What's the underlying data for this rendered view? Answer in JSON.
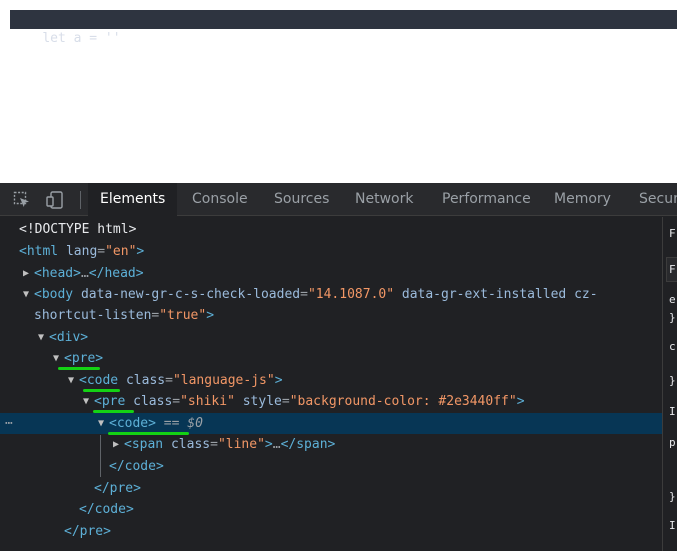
{
  "page": {
    "code_line": "let a = ''"
  },
  "devtools": {
    "tabs": [
      "Elements",
      "Console",
      "Sources",
      "Network",
      "Performance",
      "Memory",
      "Securi"
    ],
    "active_tab": "Elements",
    "tree": {
      "doctype": "<!DOCTYPE html>",
      "html_open": "<html",
      "html_attr": "lang",
      "html_val": "\"en\"",
      "head": "<head>",
      "head_close": "</head>",
      "body_open": "<body",
      "body_attr1": "data-new-gr-c-s-check-loaded",
      "body_val1": "\"14.1087.0\"",
      "body_attr2": "data-gr-ext-installed",
      "body_attr3": "cz-",
      "body_attr3b": "shortcut-listen",
      "body_val3": "\"true\"",
      "div": "<div>",
      "pre": "<pre>",
      "code_open": "<code",
      "code_attr": "class",
      "code_val": "\"language-js\"",
      "pre2_open": "<pre",
      "pre2_attr1": "class",
      "pre2_val1": "\"shiki\"",
      "pre2_attr2": "style",
      "pre2_val2": "\"background-color: #2e3440ff\"",
      "code_sel": "<code>",
      "selected_marker": "== $0",
      "row_dots": "…",
      "span_open": "<span",
      "span_attr": "class",
      "span_val": "\"line\"",
      "span_close": "</span>",
      "code_close": "</code>",
      "pre_close": "</pre>",
      "code_close2": "</code>",
      "pre_close2": "</pre>"
    },
    "side_pane": [
      "F",
      "e",
      "}",
      "c",
      "}",
      "I",
      "p",
      "}",
      "I"
    ]
  },
  "colors": {
    "code_bg": "#2e3440",
    "selection": "#073655",
    "annotation": "#14d214"
  }
}
